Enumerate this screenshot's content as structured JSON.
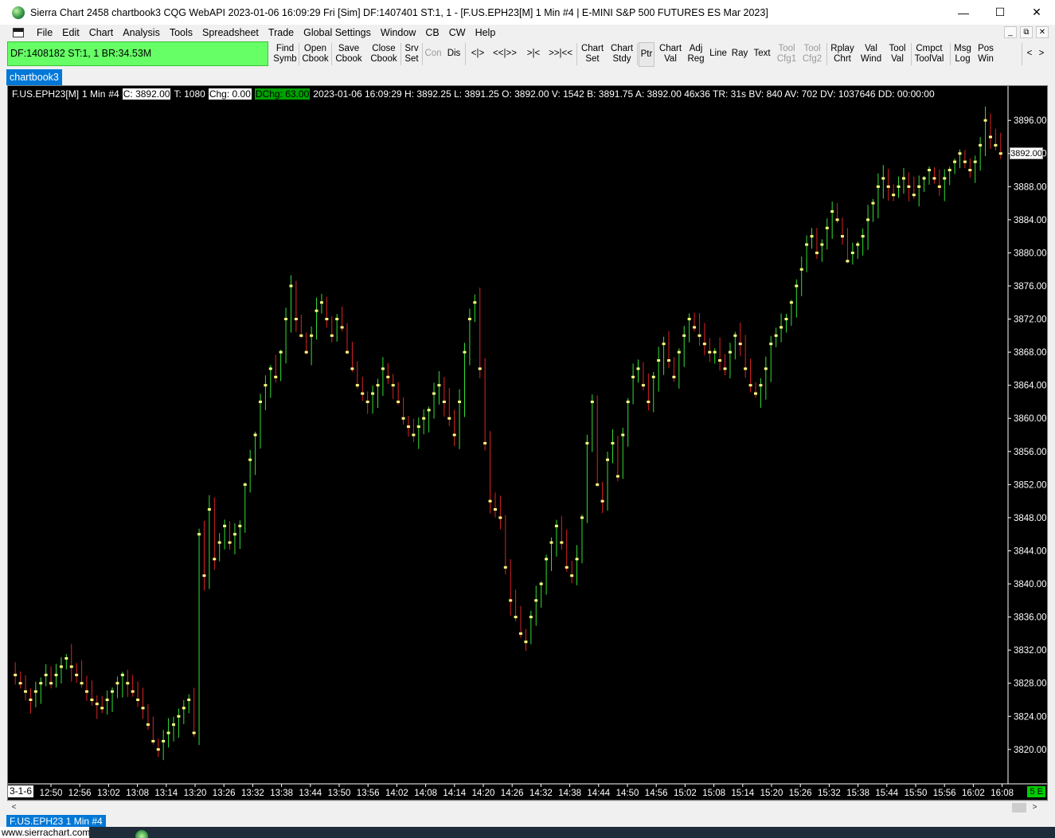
{
  "window": {
    "title": "Sierra Chart 2458 chartbook3  CQG WebAPI 2023-01-06  16:09:29 Fri [Sim]  DF:1407401  ST:1, 1 - [F.US.EPH23[M]  1 Min  #4 | E-MINI S&P 500 FUTURES ES Mar 2023]",
    "minimize": "—",
    "maximize": "☐",
    "close": "✕"
  },
  "menu": {
    "items": [
      "File",
      "Edit",
      "Chart",
      "Analysis",
      "Tools",
      "Spreadsheet",
      "Trade",
      "Global Settings",
      "Window",
      "CB",
      "CW",
      "Help"
    ],
    "mdi": [
      "_",
      "⧉",
      "✕"
    ]
  },
  "toolbar": {
    "status": "DF:1408182  ST:1, 1   BR:34.53M",
    "buttons": [
      {
        "label": "Find\nSymb",
        "enabled": true
      },
      {
        "label": "Open\nCbook",
        "enabled": true
      },
      {
        "label": "Save\nCbook",
        "enabled": true
      },
      {
        "label": "Close\nCbook",
        "enabled": true
      },
      {
        "label": "Srv\nSet",
        "enabled": true
      },
      {
        "label": "Con",
        "enabled": false
      },
      {
        "label": "Dis",
        "enabled": true
      },
      {
        "label": "<|>",
        "enabled": true
      },
      {
        "label": "<<|>>",
        "enabled": true
      },
      {
        "label": ">|<",
        "enabled": true
      },
      {
        "label": ">>|<<",
        "enabled": true
      },
      {
        "label": "Chart\nSet",
        "enabled": true
      },
      {
        "label": "Chart\nStdy",
        "enabled": true
      },
      {
        "label": "Ptr",
        "enabled": true
      },
      {
        "label": "Chart\nVal",
        "enabled": true
      },
      {
        "label": "Adj\nReg",
        "enabled": true
      },
      {
        "label": "Line",
        "enabled": true
      },
      {
        "label": "Ray",
        "enabled": true
      },
      {
        "label": "Text",
        "enabled": true
      },
      {
        "label": "Tool\nCfg1",
        "enabled": false
      },
      {
        "label": "Tool\nCfg2",
        "enabled": false
      },
      {
        "label": "Rplay\nChrt",
        "enabled": true
      },
      {
        "label": "Val\nWind",
        "enabled": true
      },
      {
        "label": "Tool\nVal",
        "enabled": true
      },
      {
        "label": "Cmpct\nToolVal",
        "enabled": true
      },
      {
        "label": "Msg\nLog",
        "enabled": true
      },
      {
        "label": "Pos\nWin",
        "enabled": true
      },
      {
        "label": "<",
        "enabled": true
      },
      {
        "label": ">",
        "enabled": true
      }
    ]
  },
  "chartbook_tab": "chartbook3",
  "chart": {
    "symbol": "F.US.EPH23[M]",
    "interval": "1 Min",
    "chart_number": "#4",
    "close_label": "C: 3892.00",
    "trades": "T: 1080",
    "change": "Chg: 0.00",
    "daily_change": "DChg: 63.00",
    "stats": "2023-01-06 16:09:29 H: 3892.25 L: 3891.25 O: 3892.00 V: 1542 B: 3891.75 A: 3892.00 46x36 TR: 31s BV: 840 AV: 702 DV: 1037646 DD: 00:00:00",
    "current_price": "3892.00",
    "date_label": "3-1-6",
    "se_label": "5 E",
    "bar_tab": "F.US.EPH23  1 Min   #4",
    "colors": {
      "background": "#000000",
      "up": "#33dd33",
      "down": "#dd2222",
      "close_tick": "#ffff80",
      "axis_text": "#ffffff"
    }
  },
  "chart_data": {
    "type": "ohlc",
    "ylim": [
      3817,
      3899
    ],
    "yticks": [
      "3820.00",
      "3824.00",
      "3828.00",
      "3832.00",
      "3836.00",
      "3840.00",
      "3844.00",
      "3848.00",
      "3852.00",
      "3856.00",
      "3860.00",
      "3864.00",
      "3868.00",
      "3872.00",
      "3876.00",
      "3880.00",
      "3884.00",
      "3888.00",
      "3892.00",
      "3896.00"
    ],
    "xticks": [
      "12:50",
      "12:56",
      "13:02",
      "13:08",
      "13:14",
      "13:20",
      "13:26",
      "13:32",
      "13:38",
      "13:44",
      "13:50",
      "13:56",
      "14:02",
      "14:08",
      "14:14",
      "14:20",
      "14:26",
      "14:32",
      "14:38",
      "14:44",
      "14:50",
      "14:56",
      "15:02",
      "15:08",
      "15:14",
      "15:20",
      "15:26",
      "15:32",
      "15:38",
      "15:44",
      "15:50",
      "15:56",
      "16:02",
      "16:08"
    ],
    "close_path": [
      3829,
      3828,
      3827,
      3826,
      3827,
      3828,
      3829,
      3828,
      3829,
      3830,
      3831,
      3830,
      3829,
      3828,
      3827,
      3826,
      3825.5,
      3825,
      3826,
      3827,
      3828,
      3829,
      3828,
      3827,
      3826,
      3825,
      3823,
      3821,
      3820,
      3821,
      3822,
      3823,
      3824,
      3825,
      3826,
      3822,
      3846,
      3841,
      3849,
      3843,
      3845,
      3847,
      3845,
      3846,
      3847,
      3852,
      3855,
      3858,
      3862,
      3864,
      3866,
      3865,
      3868,
      3872,
      3876,
      3872,
      3870,
      3868,
      3870,
      3873,
      3874,
      3872,
      3870,
      3872,
      3871,
      3868,
      3866,
      3864,
      3863,
      3862,
      3863,
      3864,
      3866,
      3865,
      3864,
      3862,
      3860,
      3859,
      3858,
      3859,
      3860,
      3861,
      3863,
      3864,
      3862,
      3860,
      3858,
      3862,
      3868,
      3872,
      3874,
      3866,
      3857,
      3850,
      3849,
      3848,
      3842,
      3838,
      3836,
      3834,
      3833,
      3836,
      3838,
      3840,
      3843,
      3845,
      3847,
      3845,
      3842,
      3841,
      3843,
      3848,
      3857,
      3862,
      3852,
      3850,
      3855,
      3857,
      3853,
      3858,
      3862,
      3865,
      3866,
      3864,
      3862,
      3865,
      3867,
      3869,
      3867,
      3865,
      3868,
      3870,
      3872,
      3871,
      3870,
      3869,
      3868,
      3868,
      3867,
      3866,
      3868,
      3870,
      3869,
      3866,
      3864,
      3863,
      3864,
      3866,
      3869,
      3870,
      3871,
      3872,
      3874,
      3876,
      3878,
      3881,
      3882,
      3880,
      3881,
      3883,
      3885,
      3884,
      3882,
      3879,
      3880,
      3881,
      3882,
      3884,
      3886,
      3888,
      3889,
      3888,
      3887,
      3888,
      3889,
      3888,
      3887,
      3888,
      3889,
      3890,
      3889,
      3888,
      3889,
      3890,
      3891,
      3892,
      3891,
      3890,
      3891,
      3893,
      3896,
      3894,
      3893,
      3892
    ]
  },
  "scrollbar": {
    "left": "<",
    "right": ">"
  },
  "website": "www.sierrachart.com"
}
